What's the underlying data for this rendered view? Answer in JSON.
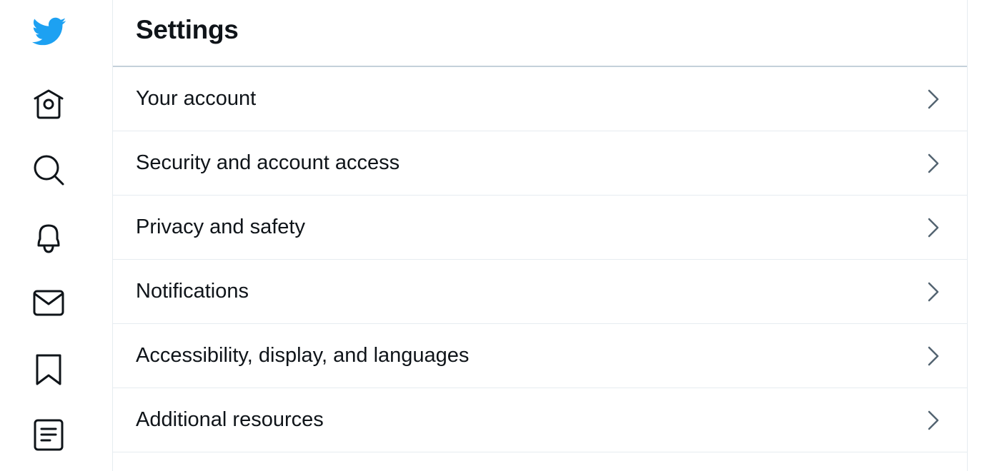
{
  "header": {
    "title": "Settings"
  },
  "nav": {
    "items": [
      {
        "name": "logo",
        "icon": "twitter-bird-icon",
        "color": "#1da1f2"
      },
      {
        "name": "home",
        "icon": "home-icon"
      },
      {
        "name": "explore",
        "icon": "search-icon"
      },
      {
        "name": "notifications",
        "icon": "bell-icon"
      },
      {
        "name": "messages",
        "icon": "mail-icon"
      },
      {
        "name": "bookmarks",
        "icon": "bookmark-icon"
      },
      {
        "name": "lists",
        "icon": "list-document-icon"
      }
    ]
  },
  "settings": {
    "items": [
      {
        "label": "Your account"
      },
      {
        "label": "Security and account access"
      },
      {
        "label": "Privacy and safety"
      },
      {
        "label": "Notifications"
      },
      {
        "label": "Accessibility, display, and languages"
      },
      {
        "label": "Additional resources"
      }
    ],
    "chevron_icon": "chevron-right-icon",
    "chevron_color": "#536471"
  },
  "colors": {
    "brand": "#1da1f2",
    "text": "#0f1419",
    "divider": "#e6ecf0",
    "header_divider": "#c4d0da"
  }
}
